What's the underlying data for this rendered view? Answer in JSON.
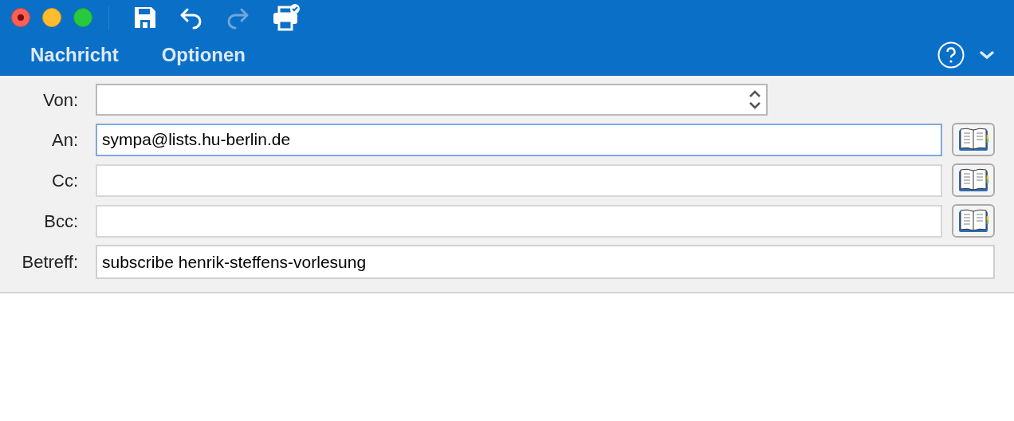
{
  "toolbar": [
    {
      "kind": "save",
      "disabled": false
    },
    {
      "kind": "undo",
      "disabled": false
    },
    {
      "kind": "redo",
      "disabled": true
    },
    {
      "kind": "print",
      "disabled": false
    }
  ],
  "tabs": [
    "Nachricht",
    "Optionen"
  ],
  "fields": [
    {
      "kind": "select",
      "label": "Von:",
      "focused": false
    },
    {
      "kind": "address",
      "label": "An:",
      "value": "sympa@lists.hu-berlin.de",
      "focused": true
    },
    {
      "kind": "address",
      "label": "Cc:",
      "focused": false
    },
    {
      "kind": "address",
      "label": "Bcc:",
      "focused": false
    },
    {
      "kind": "text",
      "label": "Betreff:",
      "value": "subscribe henrik-steffens-vorlesung",
      "focused": false
    }
  ]
}
